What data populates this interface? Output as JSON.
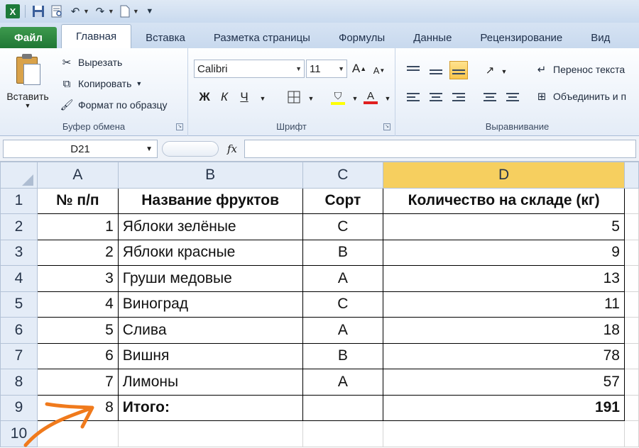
{
  "app": {
    "logo": "X"
  },
  "tabs": [
    {
      "label": "Файл",
      "type": "file"
    },
    {
      "label": "Главная",
      "type": "active"
    },
    {
      "label": "Вставка"
    },
    {
      "label": "Разметка страницы"
    },
    {
      "label": "Формулы"
    },
    {
      "label": "Данные"
    },
    {
      "label": "Рецензирование"
    },
    {
      "label": "Вид"
    }
  ],
  "ribbon": {
    "clipboard": {
      "paste": "Вставить",
      "cut": "Вырезать",
      "copy": "Копировать",
      "format_painter": "Формат по образцу",
      "label": "Буфер обмена"
    },
    "font": {
      "name": "Calibri",
      "size": "11",
      "bold": "Ж",
      "italic": "К",
      "underline": "Ч",
      "label": "Шрифт"
    },
    "alignment": {
      "wrap": "Перенос текста",
      "merge": "Объединить и п",
      "label": "Выравнивание"
    }
  },
  "formula_bar": {
    "name_box": "D21",
    "fx": "fx",
    "value": ""
  },
  "sheet": {
    "columns": [
      "A",
      "B",
      "C",
      "D"
    ],
    "selected_column": "D",
    "rows": [
      {
        "n": "1",
        "a": "№ п/п",
        "b": "Название фруктов",
        "c": "Сорт",
        "d": "Количество на складе (кг)"
      },
      {
        "n": "2",
        "a": "1",
        "b": "Яблоки зелёные",
        "c": "C",
        "d": "5"
      },
      {
        "n": "3",
        "a": "2",
        "b": "Яблоки красные",
        "c": "B",
        "d": "9"
      },
      {
        "n": "4",
        "a": "3",
        "b": "Груши медовые",
        "c": "A",
        "d": "13"
      },
      {
        "n": "5",
        "a": "4",
        "b": "Виноград",
        "c": "C",
        "d": "11"
      },
      {
        "n": "6",
        "a": "5",
        "b": "Слива",
        "c": "A",
        "d": "18"
      },
      {
        "n": "7",
        "a": "6",
        "b": "Вишня",
        "c": "B",
        "d": "78"
      },
      {
        "n": "8",
        "a": "7",
        "b": "Лимоны",
        "c": "A",
        "d": "57"
      },
      {
        "n": "9",
        "a": "8",
        "b": "Итого:",
        "c": "",
        "d": "191"
      },
      {
        "n": "10",
        "a": "",
        "b": "",
        "c": "",
        "d": ""
      }
    ]
  },
  "colors": {
    "accent": "#1d7a3a",
    "selection": "#f6cf5f",
    "annotation_arrow": "#f07a1c"
  }
}
